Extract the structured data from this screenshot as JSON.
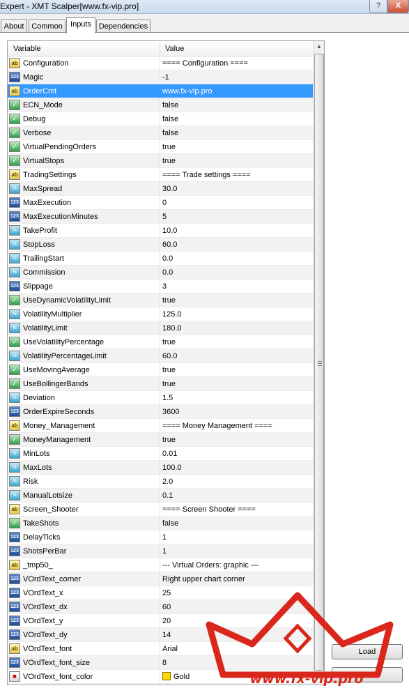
{
  "window": {
    "title": "Expert - XMT Scalper[www.fx-vip.pro]",
    "help_label": "?",
    "close_label": "X"
  },
  "tabs": [
    {
      "label": "About",
      "active": false
    },
    {
      "label": "Common",
      "active": false
    },
    {
      "label": "Inputs",
      "active": true
    },
    {
      "label": "Dependencies",
      "active": false
    }
  ],
  "table": {
    "headers": {
      "variable": "Variable",
      "value": "Value"
    },
    "rows": [
      {
        "icon": "ab",
        "variable": "Configuration",
        "value": "==== Configuration ===="
      },
      {
        "icon": "123",
        "variable": "Magic",
        "value": "-1"
      },
      {
        "icon": "ab",
        "variable": "OrderCmt",
        "value": "www.fx-vip.pro",
        "selected": true
      },
      {
        "icon": "bool",
        "variable": "ECN_Mode",
        "value": "false"
      },
      {
        "icon": "bool",
        "variable": "Debug",
        "value": "false"
      },
      {
        "icon": "bool",
        "variable": "Verbose",
        "value": "false"
      },
      {
        "icon": "bool",
        "variable": "VirtualPendingOrders",
        "value": "true"
      },
      {
        "icon": "bool",
        "variable": "VirtualStops",
        "value": "true"
      },
      {
        "icon": "ab",
        "variable": "TradingSettings",
        "value": "==== Trade settings ===="
      },
      {
        "icon": "dbl",
        "variable": "MaxSpread",
        "value": "30.0"
      },
      {
        "icon": "123",
        "variable": "MaxExecution",
        "value": "0"
      },
      {
        "icon": "123",
        "variable": "MaxExecutionMinutes",
        "value": "5"
      },
      {
        "icon": "dbl",
        "variable": "TakeProfit",
        "value": "10.0"
      },
      {
        "icon": "dbl",
        "variable": "StopLoss",
        "value": "60.0"
      },
      {
        "icon": "dbl",
        "variable": "TrailingStart",
        "value": "0.0"
      },
      {
        "icon": "dbl",
        "variable": "Commission",
        "value": "0.0"
      },
      {
        "icon": "123",
        "variable": "Slippage",
        "value": "3"
      },
      {
        "icon": "bool",
        "variable": "UseDynamicVolatilityLimit",
        "value": "true"
      },
      {
        "icon": "dbl",
        "variable": "VolatilityMultiplier",
        "value": "125.0"
      },
      {
        "icon": "dbl",
        "variable": "VolatilityLimit",
        "value": "180.0"
      },
      {
        "icon": "bool",
        "variable": "UseVolatilityPercentage",
        "value": "true"
      },
      {
        "icon": "dbl",
        "variable": "VolatilityPercentageLimit",
        "value": "60.0"
      },
      {
        "icon": "bool",
        "variable": "UseMovingAverage",
        "value": "true"
      },
      {
        "icon": "bool",
        "variable": "UseBollingerBands",
        "value": "true"
      },
      {
        "icon": "dbl",
        "variable": "Deviation",
        "value": "1.5"
      },
      {
        "icon": "123",
        "variable": "OrderExpireSeconds",
        "value": "3600"
      },
      {
        "icon": "ab",
        "variable": "Money_Management",
        "value": "==== Money Management ===="
      },
      {
        "icon": "bool",
        "variable": "MoneyManagement",
        "value": "true"
      },
      {
        "icon": "dbl",
        "variable": "MinLots",
        "value": "0.01"
      },
      {
        "icon": "dbl",
        "variable": "MaxLots",
        "value": "100.0"
      },
      {
        "icon": "dbl",
        "variable": "Risk",
        "value": "2.0"
      },
      {
        "icon": "dbl",
        "variable": "ManualLotsize",
        "value": "0.1"
      },
      {
        "icon": "ab",
        "variable": "Screen_Shooter",
        "value": "==== Screen Shooter ===="
      },
      {
        "icon": "bool",
        "variable": "TakeShots",
        "value": "false"
      },
      {
        "icon": "123",
        "variable": "DelayTicks",
        "value": "1"
      },
      {
        "icon": "123",
        "variable": "ShotsPerBar",
        "value": "1"
      },
      {
        "icon": "ab",
        "variable": "_tmp50_",
        "value": "--- Virtual Orders: graphic ---"
      },
      {
        "icon": "123",
        "variable": "VOrdText_corner",
        "value": "Right upper chart corner"
      },
      {
        "icon": "123",
        "variable": "VOrdText_x",
        "value": "25"
      },
      {
        "icon": "123",
        "variable": "VOrdText_dx",
        "value": "60"
      },
      {
        "icon": "123",
        "variable": "VOrdText_y",
        "value": "20"
      },
      {
        "icon": "123",
        "variable": "VOrdText_dy",
        "value": "14"
      },
      {
        "icon": "ab",
        "variable": "VOrdText_font",
        "value": "Arial"
      },
      {
        "icon": "123",
        "variable": "VOrdText_font_size",
        "value": "8"
      },
      {
        "icon": "clr",
        "variable": "VOrdText_font_color",
        "value": "Gold",
        "swatch": "#ffd700"
      }
    ]
  },
  "buttons": {
    "load": "Load"
  },
  "watermark": {
    "text": "www.fx-vip.pro",
    "color": "#d9281b"
  }
}
